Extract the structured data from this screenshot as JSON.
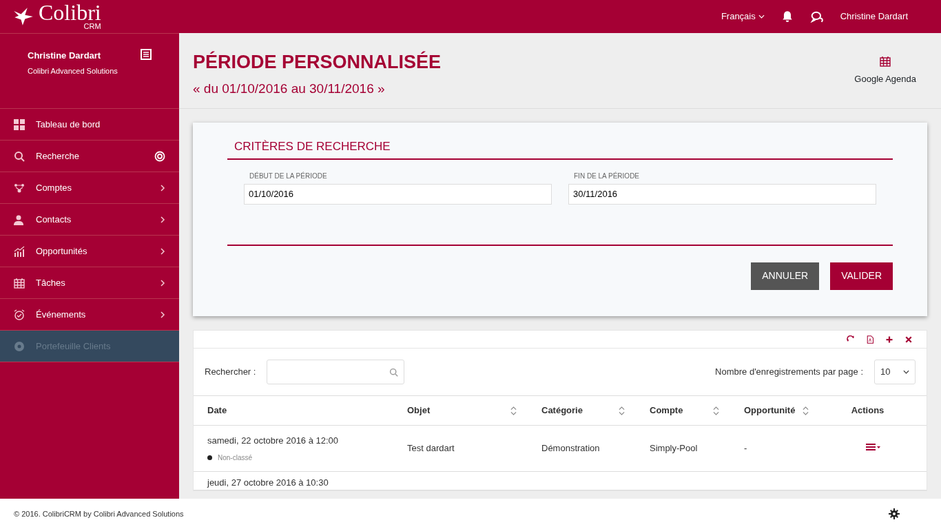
{
  "topbar": {
    "logo": "Colibri",
    "logo_sub": "CRM",
    "language": "Français",
    "user": "Christine Dardart"
  },
  "profile": {
    "name": "Christine Dardart",
    "company": "Colibri Advanced Solutions"
  },
  "sidebar": {
    "items": [
      {
        "label": "Tableau de bord",
        "kind": "plain",
        "selected": false
      },
      {
        "label": "Recherche",
        "kind": "target",
        "selected": false
      },
      {
        "label": "Comptes",
        "kind": "arrow",
        "selected": false
      },
      {
        "label": "Contacts",
        "kind": "arrow",
        "selected": false
      },
      {
        "label": "Opportunités",
        "kind": "arrow",
        "selected": false
      },
      {
        "label": "Tâches",
        "kind": "arrow",
        "selected": false
      },
      {
        "label": "Événements",
        "kind": "arrow",
        "selected": false
      },
      {
        "label": "Portefeuille Clients",
        "kind": "plain",
        "selected": true
      }
    ]
  },
  "page": {
    "title": "PÉRIODE PERSONNALISÉE",
    "subtitle": "« du 01/10/2016 au 30/11/2016 »",
    "agenda": "Google Agenda"
  },
  "criteria": {
    "title": "CRITÈRES DE RECHERCHE",
    "fields": [
      {
        "label": "DÉBUT DE LA PÉRIODE",
        "value": "01/10/2016"
      },
      {
        "label": "FIN DE LA PÉRIODE",
        "value": "30/11/2016"
      }
    ],
    "cancel": "ANNULER",
    "submit": "VALIDER"
  },
  "table": {
    "search_label": "Rechercher :",
    "page_size_label": "Nombre d'enregistrements par page :",
    "page_size": "10",
    "columns": [
      {
        "label": "Date",
        "sortable": false
      },
      {
        "label": "Objet",
        "sortable": true
      },
      {
        "label": "Catégorie",
        "sortable": true
      },
      {
        "label": "Compte",
        "sortable": true
      },
      {
        "label": "Opportunité",
        "sortable": true
      },
      {
        "label": "Actions",
        "sortable": false
      }
    ],
    "rows": [
      {
        "date": "samedi, 22 octobre 2016 à 12:00",
        "tag": "Non-classé",
        "color": "#222222",
        "objet": "Test dardart",
        "categorie": "Démonstration",
        "compte": "Simply-Pool",
        "opportunite": "-"
      },
      {
        "date": "jeudi, 27 octobre 2016 à 10:30"
      }
    ]
  },
  "footer": {
    "prefix": "© 2016.",
    "brand": "ColibriCRM",
    "middle": "by",
    "company": "Colibri Advanced Solutions"
  }
}
